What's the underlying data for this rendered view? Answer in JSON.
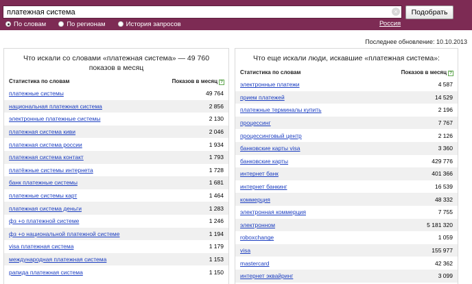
{
  "search": {
    "query": "платежная система",
    "submit_label": "Подобрать",
    "clear_glyph": "×"
  },
  "tabs": [
    {
      "label": "По словам",
      "selected": true
    },
    {
      "label": "По регионам",
      "selected": false
    },
    {
      "label": "История запросов",
      "selected": false
    }
  ],
  "region": "Россия",
  "last_update": "Последнее обновление: 10.10.2013",
  "left_panel": {
    "title": "Что искали со словами «платежная система» — 49 760 показов в месяц",
    "col_phrase": "Статистика по словам",
    "col_count": "Показов в месяц",
    "help_glyph": "?",
    "rows": [
      {
        "phrase": "платежные системы",
        "count": "49 764"
      },
      {
        "phrase": "национальная платежная система",
        "count": "2 856"
      },
      {
        "phrase": "электронные платежные системы",
        "count": "2 130"
      },
      {
        "phrase": "платежная система киви",
        "count": "2 046"
      },
      {
        "phrase": "платежная система россии",
        "count": "1 934"
      },
      {
        "phrase": "платежная система контакт",
        "count": "1 793"
      },
      {
        "phrase": "платёжные системы интернета",
        "count": "1 728"
      },
      {
        "phrase": "банк платежные системы",
        "count": "1 681"
      },
      {
        "phrase": "платежные системы карт",
        "count": "1 464"
      },
      {
        "phrase": "платежная система деньги",
        "count": "1 283"
      },
      {
        "phrase": "фз +о платежной системе",
        "count": "1 246"
      },
      {
        "phrase": "фз +о национальной платежной системе",
        "count": "1 194"
      },
      {
        "phrase": "visa платежная система",
        "count": "1 179"
      },
      {
        "phrase": "международная платежная система",
        "count": "1 153"
      },
      {
        "phrase": "рапида платежная система",
        "count": "1 150"
      }
    ]
  },
  "right_panel": {
    "title": "Что еще искали люди, искавшие «платежная система»:",
    "col_phrase": "Статистика по словам",
    "col_count": "Показов в месяц",
    "help_glyph": "?",
    "rows": [
      {
        "phrase": "электронные платежи",
        "count": "4 587"
      },
      {
        "phrase": "прием платежей",
        "count": "14 529"
      },
      {
        "phrase": "платежные терминалы купить",
        "count": "2 196"
      },
      {
        "phrase": "процессинг",
        "count": "7 767"
      },
      {
        "phrase": "процессинговый центр",
        "count": "2 126"
      },
      {
        "phrase": "банковские карты visa",
        "count": "3 360"
      },
      {
        "phrase": "банковские карты",
        "count": "429 776"
      },
      {
        "phrase": "интернет банк",
        "count": "401 366"
      },
      {
        "phrase": "интернет банкинг",
        "count": "16 539"
      },
      {
        "phrase": "коммерция",
        "count": "48 332"
      },
      {
        "phrase": "электронная коммерция",
        "count": "7 755"
      },
      {
        "phrase": "электронном",
        "count": "5 181 320"
      },
      {
        "phrase": "roboxchange",
        "count": "1 059"
      },
      {
        "phrase": "visa",
        "count": "155 977"
      },
      {
        "phrase": "mastercard",
        "count": "42 362"
      },
      {
        "phrase": "интернет эквайринг",
        "count": "3 099"
      }
    ]
  }
}
